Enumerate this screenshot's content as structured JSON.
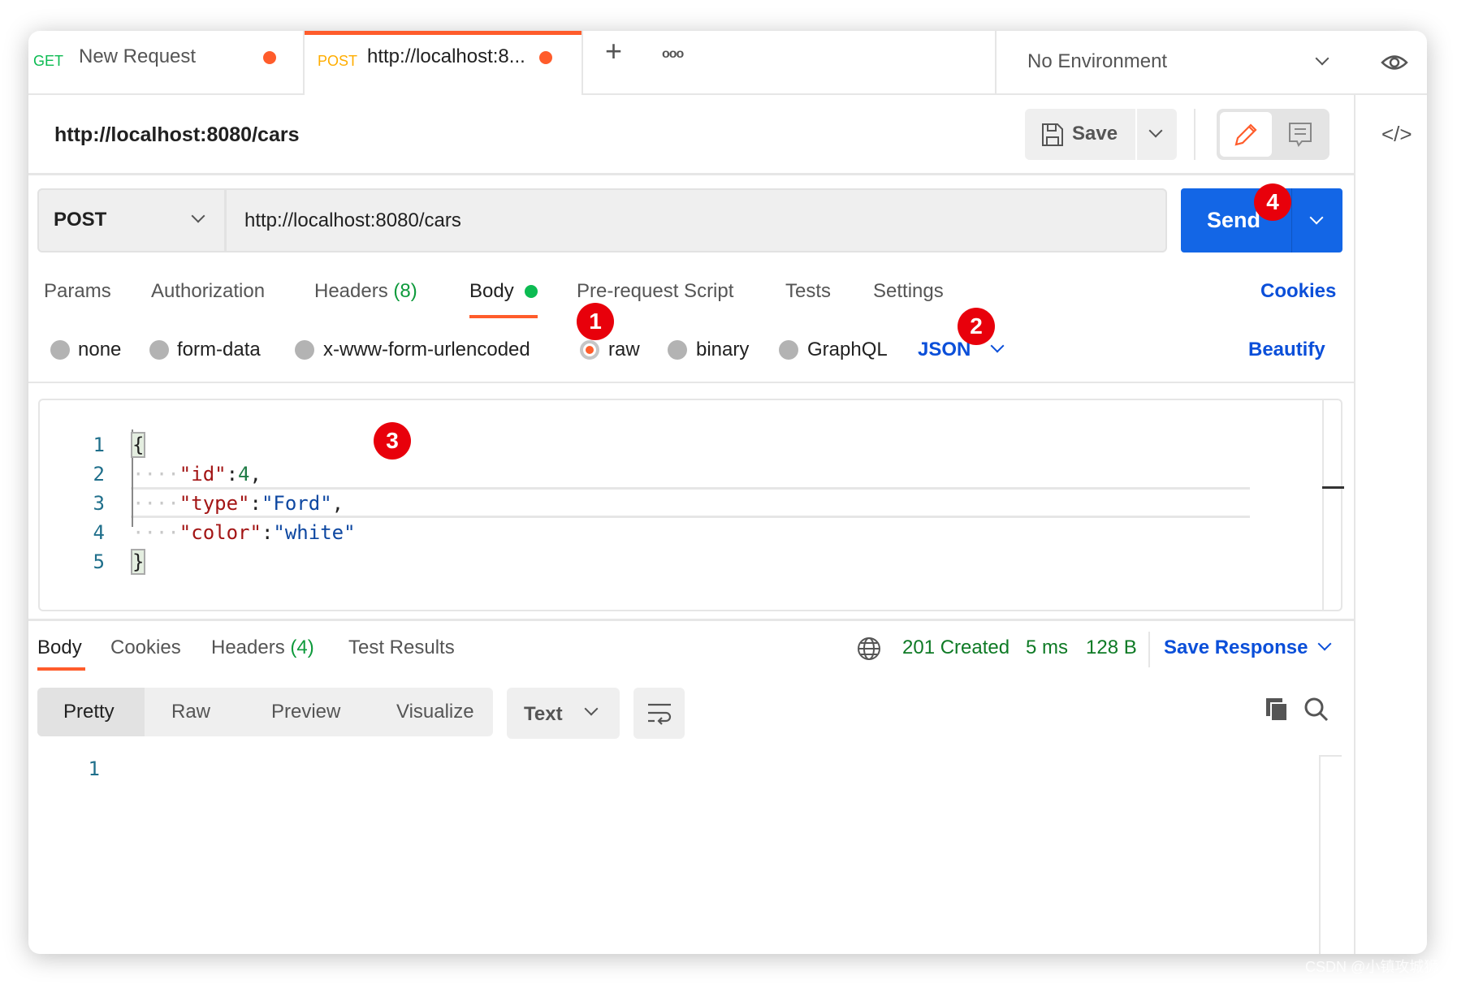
{
  "tabs": [
    {
      "method": "GET",
      "method_color": "#0cbb52",
      "label": "New Request",
      "unsaved": true
    },
    {
      "method": "POST",
      "method_color": "#ffad00",
      "label": "http://localhost:8...",
      "unsaved": true,
      "active": true
    }
  ],
  "tab_actions": {
    "new": "+",
    "more": "ooo"
  },
  "environment": {
    "selected": "No Environment"
  },
  "request": {
    "title": "http://localhost:8080/cars",
    "save_label": "Save",
    "method": "POST",
    "url": "http://localhost:8080/cars",
    "send_label": "Send"
  },
  "request_tabs": {
    "params": "Params",
    "authorization": "Authorization",
    "headers": "Headers",
    "headers_count": "(8)",
    "body": "Body",
    "prerequest": "Pre-request Script",
    "tests": "Tests",
    "settings": "Settings",
    "cookies": "Cookies"
  },
  "body_types": {
    "none": "none",
    "form_data": "form-data",
    "urlencoded": "x-www-form-urlencoded",
    "raw": "raw",
    "binary": "binary",
    "graphql": "GraphQL",
    "selected": "raw",
    "format": "JSON",
    "beautify": "Beautify"
  },
  "editor": {
    "line_numbers": [
      "1",
      "2",
      "3",
      "4",
      "5"
    ],
    "lines": [
      [
        {
          "c": "brace",
          "t": "{"
        }
      ],
      [
        {
          "c": "ws",
          "t": "····"
        },
        {
          "c": "k",
          "t": "\"id\""
        },
        {
          "c": "p",
          "t": ":"
        },
        {
          "c": "n",
          "t": "4"
        },
        {
          "c": "p",
          "t": ","
        }
      ],
      [
        {
          "c": "ws",
          "t": "····"
        },
        {
          "c": "k",
          "t": "\"type\""
        },
        {
          "c": "p",
          "t": ":"
        },
        {
          "c": "s",
          "t": "\"Ford\""
        },
        {
          "c": "p",
          "t": ","
        }
      ],
      [
        {
          "c": "ws",
          "t": "····"
        },
        {
          "c": "k",
          "t": "\"color\""
        },
        {
          "c": "p",
          "t": ":"
        },
        {
          "c": "s",
          "t": "\"white\""
        }
      ],
      [
        {
          "c": "brace",
          "t": "}"
        }
      ]
    ]
  },
  "response": {
    "tabs": {
      "body": "Body",
      "cookies": "Cookies",
      "headers": "Headers",
      "headers_count": "(4)",
      "test_results": "Test Results"
    },
    "status": "201 Created",
    "time": "5 ms",
    "size": "128 B",
    "save_response": "Save Response",
    "views": [
      "Pretty",
      "Raw",
      "Preview",
      "Visualize"
    ],
    "selected_view": "Pretty",
    "format": "Text",
    "line_numbers": [
      "1"
    ]
  },
  "annotations": [
    "1",
    "2",
    "3",
    "4"
  ],
  "watermark": "CSDN @小镇攻城狮",
  "colors": {
    "accent": "#ff6c37",
    "send": "#1366e6",
    "link": "#0b4fd9",
    "status_ok": "#0e7a25"
  }
}
